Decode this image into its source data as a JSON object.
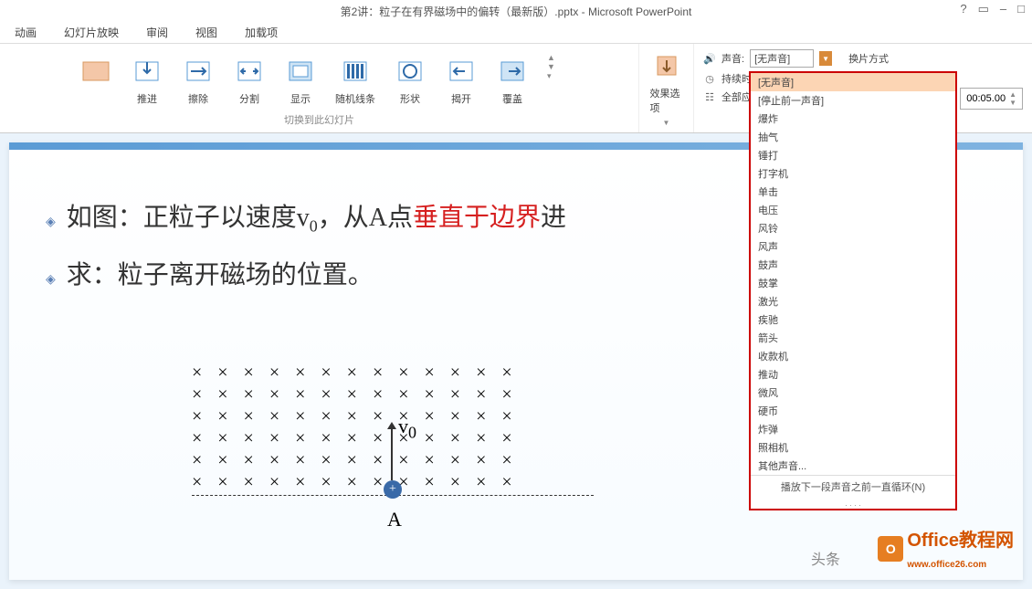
{
  "window": {
    "title": "第2讲：粒子在有界磁场中的偏转（最新版）.pptx - Microsoft PowerPoint",
    "controls": {
      "help": "?",
      "restore": "▭",
      "min": "–",
      "max": "□"
    }
  },
  "menu": {
    "items": [
      "动画",
      "幻灯片放映",
      "审阅",
      "视图",
      "加载项"
    ]
  },
  "ribbon": {
    "transitions": [
      {
        "label": "推进"
      },
      {
        "label": "擦除"
      },
      {
        "label": "分割"
      },
      {
        "label": "显示"
      },
      {
        "label": "随机线条"
      },
      {
        "label": "形状"
      },
      {
        "label": "揭开"
      },
      {
        "label": "覆盖"
      }
    ],
    "effect_options": "效果选项",
    "group_label": "切换到此幻灯片"
  },
  "timing": {
    "sound_label": "声音:",
    "sound_value": "[无声音]",
    "duration_label": "持续时",
    "apply_all_label": "全部应",
    "advance_label": "换片方式",
    "duration_value": "00:05.00"
  },
  "sound_options": [
    "[无声音]",
    "[停止前一声音]",
    "爆炸",
    "抽气",
    "锤打",
    "打字机",
    "单击",
    "电压",
    "风铃",
    "风声",
    "鼓声",
    "鼓掌",
    "激光",
    "疾驰",
    "箭头",
    "收款机",
    "推动",
    "微风",
    "硬币",
    "炸弹",
    "照相机",
    "其他声音..."
  ],
  "sound_loop": "播放下一段声音之前一直循环(N)",
  "slide": {
    "line1_pre": "如图：正粒子以速度v",
    "line1_sub": "0",
    "line1_mid": "，从A点",
    "line1_red": "垂直于边界",
    "line1_post": "进",
    "line2": "求：粒子离开磁场的位置。",
    "v_label": "v",
    "v_sub": "0",
    "a_label": "A",
    "plus": "+"
  },
  "watermark": {
    "toutiao": "头条",
    "brand": "Office教程网",
    "url": "www.office26.com"
  }
}
